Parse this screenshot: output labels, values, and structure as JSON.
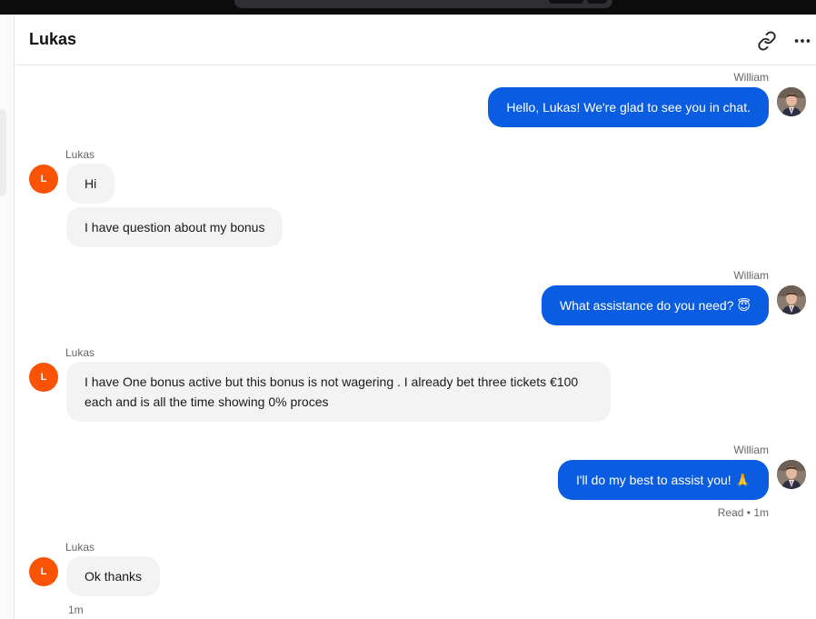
{
  "conversation": {
    "title": "Lukas"
  },
  "icons": {
    "link": "link-icon",
    "more": "more-horizontal-icon"
  },
  "colors": {
    "outgoing_bubble": "#0a5ce0",
    "incoming_bubble": "#f3f3f3",
    "customer_avatar": "#fb5306"
  },
  "customer": {
    "initial": "L",
    "name": "Lukas"
  },
  "agent": {
    "name": "William"
  },
  "messages": [
    {
      "from": "William",
      "text": "Hello, Lukas! We're glad to see you in chat."
    },
    {
      "from": "Lukas",
      "text": "Hi"
    },
    {
      "from": "Lukas",
      "text": "I have question about my bonus"
    },
    {
      "from": "William",
      "text": "What assistance do you need? 😇"
    },
    {
      "from": "Lukas",
      "text": "I have One bonus active but this bonus is not wagering . I already bet three tickets €100 each and is all the time showing 0% proces"
    },
    {
      "from": "William",
      "text": "I'll do my best to assist you! 🙏"
    },
    {
      "from": "Lukas",
      "text": "Ok thanks"
    }
  ],
  "status": {
    "read_label": "Read",
    "read_separator": "•",
    "read_time": "1m",
    "last_time": "1m"
  }
}
